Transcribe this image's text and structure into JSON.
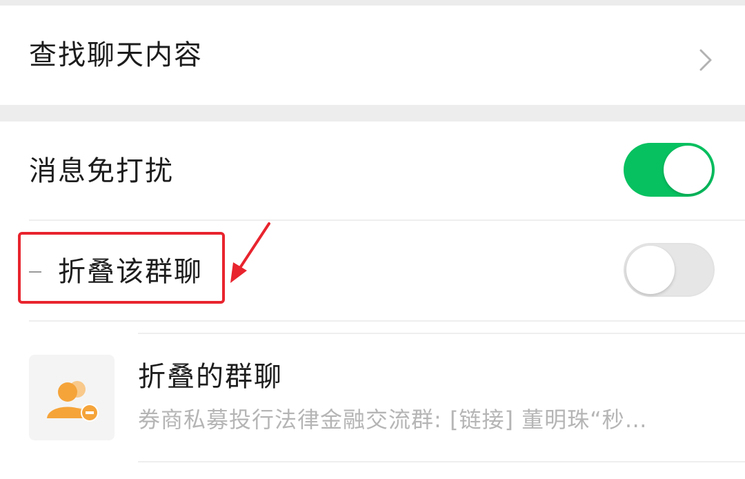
{
  "search_chat": {
    "label": "查找聊天内容",
    "icon": "chevron-right-icon"
  },
  "mute_notifications": {
    "label": "消息免打扰",
    "enabled": true,
    "accent": "#07c160"
  },
  "fold_group": {
    "label": "折叠该群聊",
    "enabled": false
  },
  "annotation": {
    "color": "#e8242e"
  },
  "folded_chats": {
    "title": "折叠的群聊",
    "preview": "券商私募投行法律金融交流群: [链接] 董明珠“秒…",
    "icon": "folded-group-icon",
    "icon_color": "#f5a43a"
  }
}
